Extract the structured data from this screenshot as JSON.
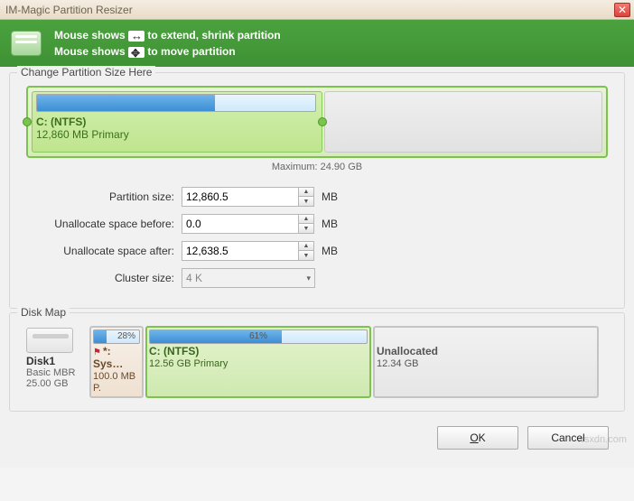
{
  "window": {
    "title": "IM-Magic Partition Resizer"
  },
  "banner": {
    "line1_prefix": "Mouse shows",
    "line1_suffix": "to extend, shrink partition",
    "line2_prefix": "Mouse shows",
    "line2_suffix": "to move partition"
  },
  "change_group": {
    "legend": "Change Partition Size Here",
    "partition_name": "C: (NTFS)",
    "partition_sub": "12,860 MB Primary",
    "max_label": "Maximum: 24.90 GB"
  },
  "form": {
    "partition_size_label": "Partition size:",
    "partition_size_value": "12,860.5",
    "unalloc_before_label": "Unallocate space before:",
    "unalloc_before_value": "0.0",
    "unalloc_after_label": "Unallocate space after:",
    "unalloc_after_value": "12,638.5",
    "cluster_label": "Cluster size:",
    "cluster_value": "4 K",
    "unit": "MB"
  },
  "diskmap": {
    "legend": "Disk Map",
    "disk": {
      "name": "Disk1",
      "type": "Basic MBR",
      "size": "25.00 GB"
    },
    "sys": {
      "percent": "28%",
      "name": "*: Sys…",
      "sub": "100.0 MB P."
    },
    "c": {
      "percent": "61%",
      "name": "C: (NTFS)",
      "sub": "12.56 GB Primary"
    },
    "un": {
      "name": "Unallocated",
      "sub": "12.34 GB"
    }
  },
  "buttons": {
    "ok": "OK",
    "cancel": "Cancel"
  },
  "watermark": "wsxdn.com"
}
